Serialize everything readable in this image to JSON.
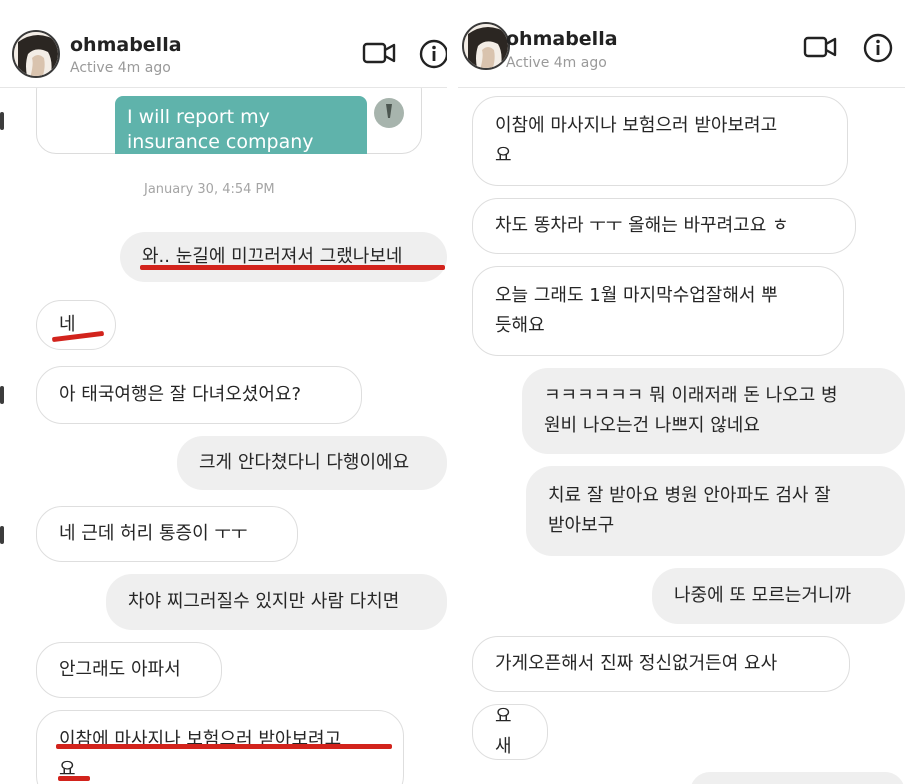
{
  "left": {
    "header": {
      "username": "ohmabella",
      "status": "Active 4m ago",
      "icons": [
        "video-call-icon",
        "info-icon"
      ]
    },
    "forwarded_text": "I will report my\ninsurance company",
    "date_label": "January 30, 4:54 PM",
    "messages": [
      "와.. 눈길에 미끄러져서 그랬나보네",
      "네",
      "아 태국여행은 잘 다녀오셨어요?",
      "크게 안다쳤다니 다행이에요",
      "네 근데 허리 통증이 ㅜㅜ",
      "차야 찌그러질수 있지만 사람 다치면",
      "안그래도 아파서",
      "이참에 마사지나 보험으러 받아보려고\n요"
    ]
  },
  "right": {
    "header": {
      "username": "ohmabella",
      "status": "Active 4m ago",
      "icons": [
        "video-call-icon",
        "info-icon"
      ]
    },
    "messages": [
      "이참에 마사지나 보험으러 받아보려고\n요",
      "차도 똥차라 ㅜㅜ 올해는 바꾸려고요 ㅎ",
      "오늘 그래도 1월 마지막수업잘해서 뿌\n듯해요",
      "ㅋㅋㅋㅋㅋㅋ 뭐 이래저래 돈 나오고 병\n원비 나오는건 나쁘지 않네요",
      "치료 잘 받아요 병원 안아파도 검사 잘\n받아보구",
      "나중에 또 모르는거니까",
      "가게오픈해서 진짜 정신없거든여 요사",
      "요새"
    ]
  },
  "colors": {
    "forwarded_bubble": "#5fb3ab",
    "annotation_underline": "#d2231c",
    "sent_bubble": "#efefef"
  }
}
